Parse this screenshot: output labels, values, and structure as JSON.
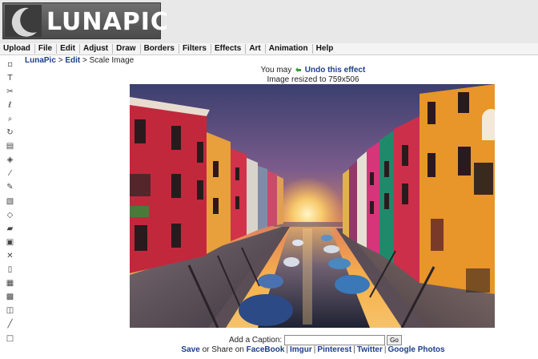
{
  "app": {
    "logo_text": "LUNAPIC"
  },
  "menu": {
    "items": [
      "Upload",
      "File",
      "Edit",
      "Adjust",
      "Draw",
      "Borders",
      "Filters",
      "Effects",
      "Art",
      "Animation",
      "Help"
    ]
  },
  "toolbar": {
    "tools": [
      {
        "name": "select-icon",
        "glyph": "▫"
      },
      {
        "name": "text-icon",
        "glyph": "T"
      },
      {
        "name": "scissors-icon",
        "glyph": "✂"
      },
      {
        "name": "lasso-icon",
        "glyph": "ℓ"
      },
      {
        "name": "zoom-icon",
        "glyph": "⌕"
      },
      {
        "name": "rotate-icon",
        "glyph": "↻"
      },
      {
        "name": "gradient-icon",
        "glyph": "▤"
      },
      {
        "name": "fill-bucket-icon",
        "glyph": "◈"
      },
      {
        "name": "eyedropper-icon",
        "glyph": "⁄"
      },
      {
        "name": "pencil-icon",
        "glyph": "✎"
      },
      {
        "name": "stamp-icon",
        "glyph": "▧"
      },
      {
        "name": "eraser-icon",
        "glyph": "◇"
      },
      {
        "name": "open-folder-icon",
        "glyph": "▰"
      },
      {
        "name": "save-icon",
        "glyph": "▣"
      },
      {
        "name": "close-icon",
        "glyph": "✕"
      },
      {
        "name": "new-page-icon",
        "glyph": "▯"
      },
      {
        "name": "print-icon",
        "glyph": "▦"
      },
      {
        "name": "printer-icon",
        "glyph": "▩"
      },
      {
        "name": "layers-icon",
        "glyph": "◫"
      },
      {
        "name": "line-icon",
        "glyph": "╱"
      },
      {
        "name": "rectangle-icon",
        "glyph": "□"
      }
    ]
  },
  "breadcrumb": {
    "root": "LunaPic",
    "sep1": ">",
    "section": "Edit",
    "sep2": ">",
    "current": "Scale Image"
  },
  "notice": {
    "prefix": "You may",
    "undo_link": "Undo this effect",
    "resize_text": "Image resized to 759x506"
  },
  "caption": {
    "label": "Add a Caption:",
    "value": "",
    "button": "Go"
  },
  "share": {
    "save": "Save",
    "or_share": "or Share on",
    "links": [
      "FaceBook",
      "Imgur",
      "Pinterest",
      "Twitter",
      "Google Photos"
    ],
    "separator": "|"
  },
  "colors": {
    "link": "#1c3e8c",
    "header_bg": "#e8e8e8"
  }
}
